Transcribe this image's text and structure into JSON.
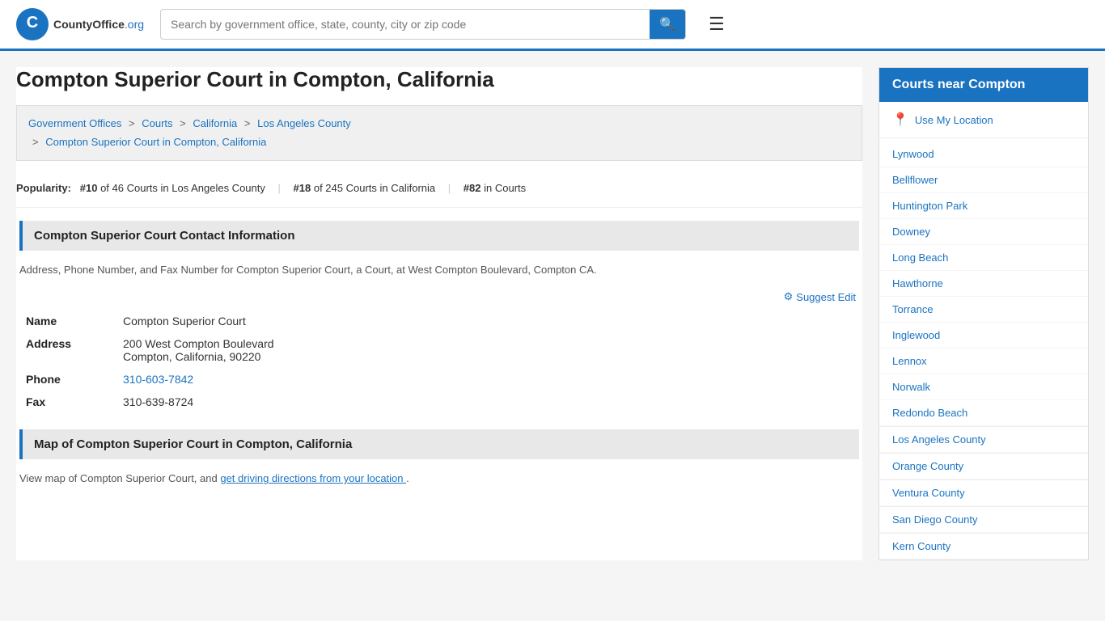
{
  "header": {
    "logo_text": "CountyOffice",
    "logo_org": ".org",
    "search_placeholder": "Search by government office, state, county, city or zip code",
    "search_button_label": "🔍",
    "menu_button_label": "☰"
  },
  "page": {
    "title": "Compton Superior Court in Compton, California"
  },
  "breadcrumb": {
    "items": [
      {
        "label": "Government Offices",
        "href": "#"
      },
      {
        "label": "Courts",
        "href": "#"
      },
      {
        "label": "California",
        "href": "#"
      },
      {
        "label": "Los Angeles County",
        "href": "#"
      },
      {
        "label": "Compton Superior Court in Compton, California",
        "href": "#"
      }
    ]
  },
  "popularity": {
    "label": "Popularity:",
    "rank1": "#10",
    "rank1_text": "of 46 Courts in Los Angeles County",
    "rank2": "#18",
    "rank2_text": "of 245 Courts in California",
    "rank3": "#82",
    "rank3_text": "in Courts"
  },
  "contact_section": {
    "header": "Compton Superior Court Contact Information",
    "description": "Address, Phone Number, and Fax Number for Compton Superior Court, a Court, at West Compton Boulevard, Compton CA.",
    "name_label": "Name",
    "name_value": "Compton Superior Court",
    "address_label": "Address",
    "address_line1": "200 West Compton Boulevard",
    "address_line2": "Compton, California, 90220",
    "phone_label": "Phone",
    "phone_value": "310-603-7842",
    "fax_label": "Fax",
    "fax_value": "310-639-8724",
    "suggest_edit_label": "Suggest Edit"
  },
  "map_section": {
    "header": "Map of Compton Superior Court in Compton, California",
    "description_prefix": "View map of Compton Superior Court, and ",
    "map_link_text": "get driving directions from your location",
    "description_suffix": "."
  },
  "sidebar": {
    "title": "Courts near Compton",
    "use_location_label": "Use My Location",
    "cities": [
      "Lynwood",
      "Bellflower",
      "Huntington Park",
      "Downey",
      "Long Beach",
      "Hawthorne",
      "Torrance",
      "Inglewood",
      "Lennox",
      "Norwalk",
      "Redondo Beach"
    ],
    "counties": [
      "Los Angeles County",
      "Orange County",
      "Ventura County",
      "San Diego County",
      "Kern County"
    ]
  }
}
